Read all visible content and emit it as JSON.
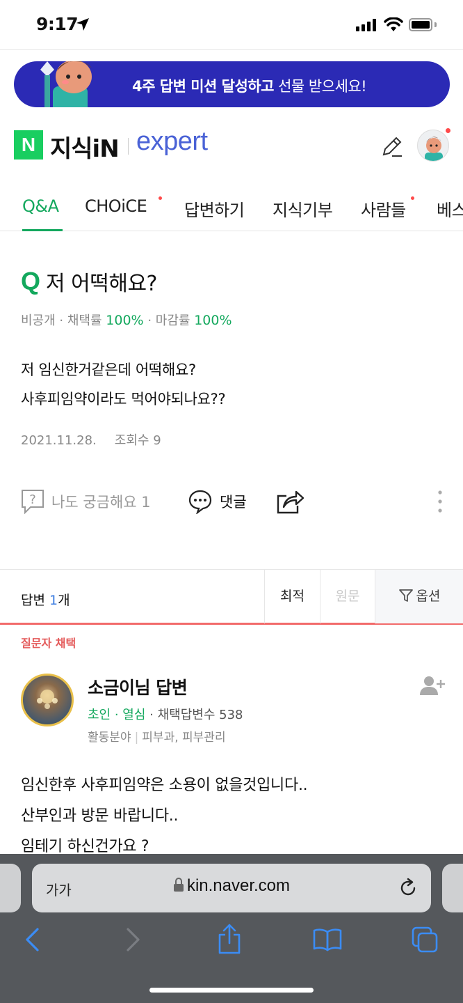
{
  "status_bar": {
    "time": "9:17"
  },
  "banner": {
    "text_bold": "4주 답변 미션 달성하고",
    "text_rest": " 선물 받으세요!"
  },
  "header": {
    "logo_n": "N",
    "brand": "지식iN",
    "expert": "expert"
  },
  "tabs": [
    {
      "label": "Q&A",
      "active": true
    },
    {
      "label": "CHOiCE",
      "dot": true
    },
    {
      "label": "답변하기"
    },
    {
      "label": "지식기부"
    },
    {
      "label": "사람들",
      "dot": true
    },
    {
      "label": "베스"
    }
  ],
  "question": {
    "mark": "Q",
    "title": "저 어떡해요?",
    "meta": {
      "privacy": "비공개",
      "adopt_label": "채택률",
      "adopt_value": "100%",
      "close_label": "마감률",
      "close_value": "100%",
      "sep": " · "
    },
    "body_lines": [
      "저 임신한거같은데 어떡해요?",
      "사후피임약이라도 먹어야되나요??"
    ],
    "date": "2021.11.28.",
    "views": "조회수 9",
    "curious": "나도 궁금해요 1",
    "comment": "댓글"
  },
  "answers_bar": {
    "label": "답변",
    "count": "1",
    "unit": "개",
    "sort_best": "최적",
    "sort_orig": "원문",
    "options": "옵션"
  },
  "answer": {
    "chosen_label": "질문자 채택",
    "name": "소금이님 답변",
    "rank1": "초인",
    "rank2": "열심",
    "adopted_label": "채택답변수 538",
    "field_label": "활동분야",
    "field_value": "피부과, 피부관리",
    "body_lines": [
      "임신한후 사후피임약은 소용이 없을것입니다..",
      "산부인과 방문 바랍니다..",
      "임테기 하신건가요 ?"
    ]
  },
  "safari": {
    "aa": "가가",
    "url": "kin.naver.com"
  },
  "colors": {
    "naver_green": "#13a85d",
    "banner_blue": "#2b2ab5",
    "expert_blue": "#4a62d6",
    "accent_red": "#f26b6b"
  }
}
